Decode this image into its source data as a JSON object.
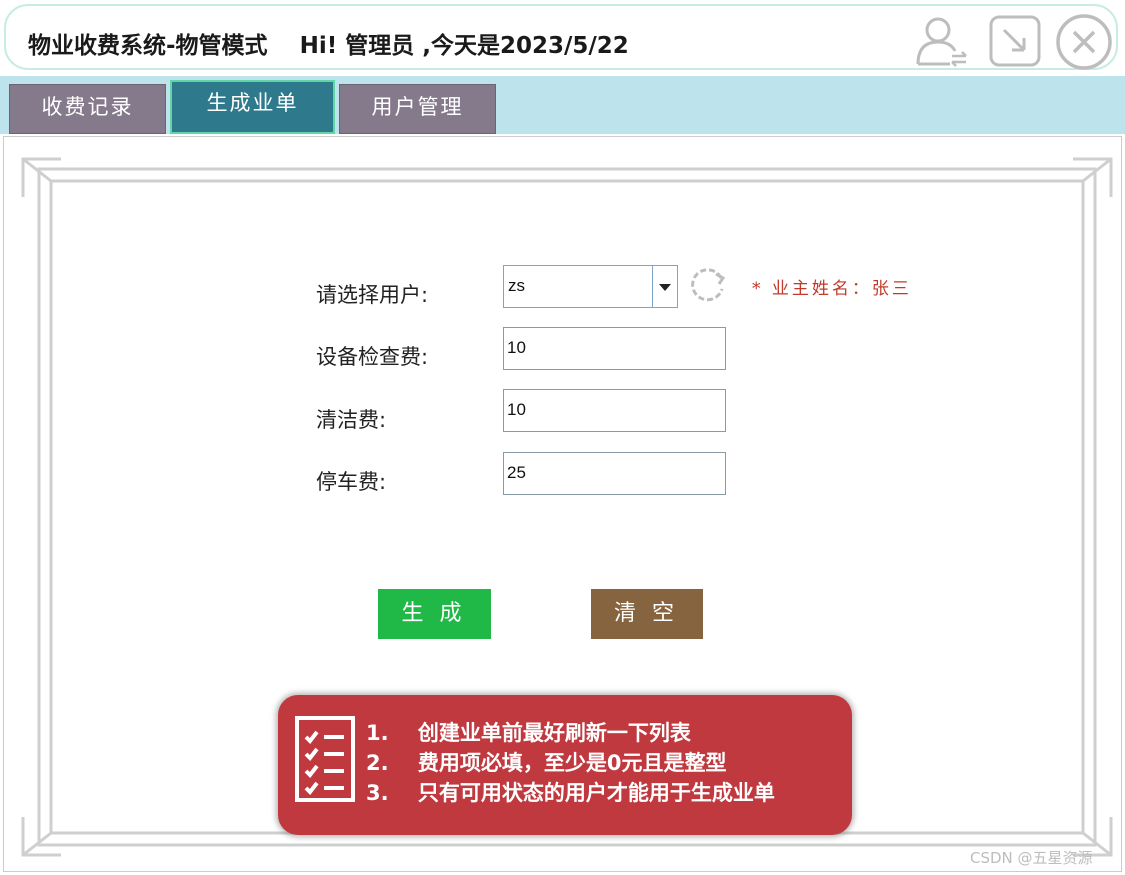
{
  "header": {
    "title": "物业收费系统-物管模式    Hi! 管理员 ,今天是2023/5/22"
  },
  "tabs": [
    {
      "label": "收费记录",
      "active": false
    },
    {
      "label": "生成业单",
      "active": true
    },
    {
      "label": "用户管理",
      "active": false
    }
  ],
  "form": {
    "user_label": "请选择用户:",
    "user_value": "zs",
    "owner_hint": "* 业主姓名：张三",
    "inspection_label": "设备检查费:",
    "inspection_value": "10",
    "cleaning_label": "清洁费:",
    "cleaning_value": "10",
    "parking_label": "停车费:",
    "parking_value": "25"
  },
  "buttons": {
    "generate": "生成",
    "clear": "清空"
  },
  "tips": [
    "1.    创建业单前最好刷新一下列表",
    "2.    费用项必填，至少是0元且是整型",
    "3.    只有可用状态的用户才能用于生成业单"
  ],
  "watermark": "CSDN @五星资源",
  "colors": {
    "tab_active": "#2e7a8c",
    "tab_inactive": "#857a8c",
    "tabbar_bg": "#bde3ed",
    "generate_button": "#20b847",
    "clear_button": "#86643f",
    "tips_bg": "#c0393f",
    "hint_text": "#c0392b"
  }
}
